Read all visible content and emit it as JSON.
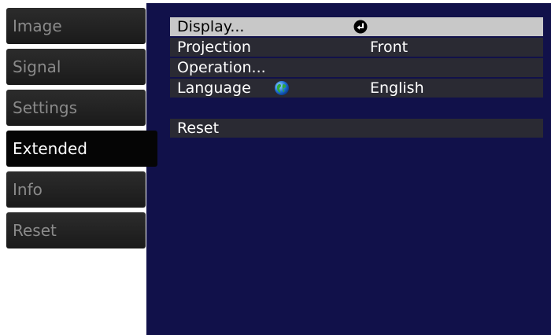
{
  "sidebar": {
    "items": [
      {
        "label": "Image"
      },
      {
        "label": "Signal"
      },
      {
        "label": "Settings"
      },
      {
        "label": "Extended",
        "active": true
      },
      {
        "label": "Info"
      },
      {
        "label": "Reset"
      }
    ]
  },
  "main": {
    "rows": [
      {
        "label": "Display...",
        "icon": "enter-icon",
        "selected": true
      },
      {
        "label": "Projection",
        "value": "Front"
      },
      {
        "label": "Operation..."
      },
      {
        "label": "Language",
        "icon": "globe-icon",
        "value": "English"
      },
      {
        "label": "Reset"
      }
    ]
  },
  "colors": {
    "panel_background": "#11114a",
    "row_background": "#2a2a33",
    "selected_row_background": "#c8c8c8",
    "sidebar_item_background": "#1f1f1f",
    "sidebar_active_background": "#050505"
  }
}
